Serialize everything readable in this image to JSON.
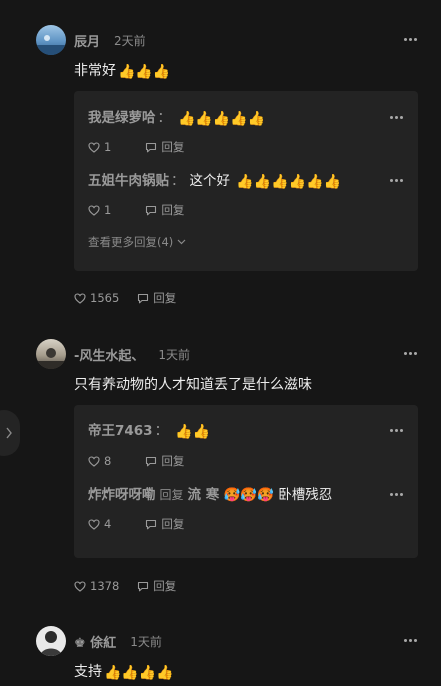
{
  "comments": [
    {
      "author": "辰月",
      "time": "2天前",
      "text": "非常好",
      "text_emoji": "👍👍👍",
      "replies": [
        {
          "author": "我是绿萝哈",
          "colon": "：",
          "content": "",
          "content_emoji": "👍👍👍👍👍",
          "likes": "1",
          "reply_label": "回复"
        },
        {
          "author": "五姐牛肉锅贴",
          "colon": "：",
          "content": "这个好",
          "content_emoji": "👍👍👍👍👍👍",
          "likes": "1",
          "reply_label": "回复"
        }
      ],
      "view_more": "查看更多回复(4)",
      "likes": "1565",
      "reply_label": "回复"
    },
    {
      "author": "-风生水起、",
      "time": "1天前",
      "text": "只有养动物的人才知道丢了是什么滋味",
      "text_emoji": "",
      "replies": [
        {
          "author": "帝王7463",
          "colon": "：",
          "content": "",
          "content_emoji": "👍👍",
          "likes": "8",
          "reply_label": "回复"
        },
        {
          "author": "炸炸呀呀嘞",
          "mid": "回复",
          "target": "流 寒",
          "colon": "",
          "content": "🥵🥵🥵 卧槽残忍",
          "content_emoji": "",
          "likes": "4",
          "reply_label": "回复"
        }
      ],
      "likes": "1378",
      "reply_label": "回复"
    },
    {
      "author": "♚ 俆紅",
      "time": "1天前",
      "text": "支持",
      "text_emoji": "👍👍👍👍"
    }
  ],
  "colors": {
    "background": "#161616",
    "reply_box": "#232323",
    "author": "#9a9a9a",
    "text": "#ededed"
  },
  "icons": {
    "more": "more-dots-icon",
    "like": "heart-icon",
    "reply": "comment-bubble-icon",
    "expand": "chevron-down-icon",
    "side": "chevron-right-icon"
  }
}
